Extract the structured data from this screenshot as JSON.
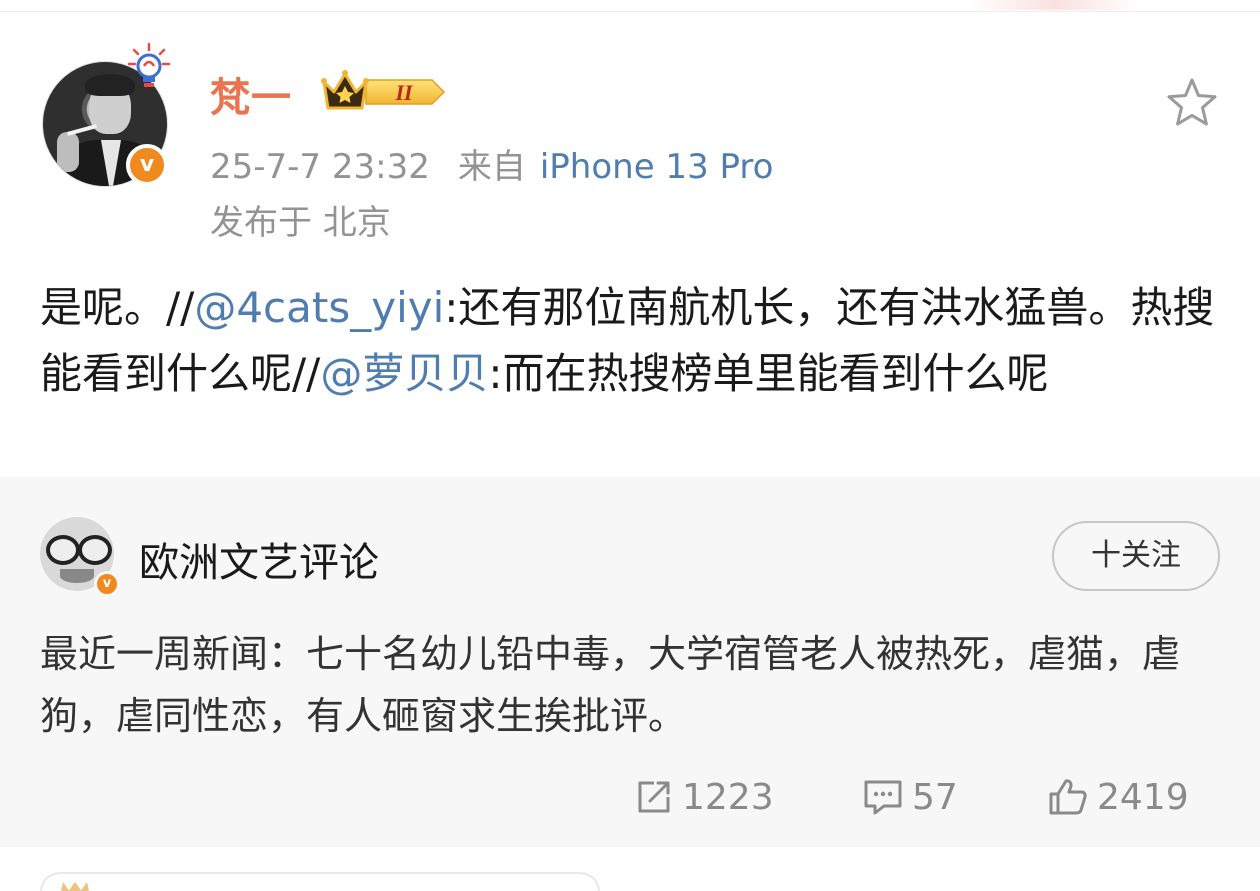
{
  "post": {
    "username": "梵一",
    "level_badge": "II",
    "verified_mark": "v",
    "date": "25-7-7 23:32",
    "source_prefix": "来自",
    "source_device": "iPhone 13 Pro",
    "location_label": "发布于 北京",
    "text": {
      "t1": "是呢。//",
      "m1": "@4cats_yiyi",
      "t2": ":还有那位南航机长，还有洪水猛兽。热搜能看到什么呢//",
      "m2": "@萝贝贝",
      "t3": ":而在热搜榜单里能看到什么呢"
    }
  },
  "repost": {
    "author": "欧洲文艺评论",
    "verified_mark": "v",
    "follow_label": "十关注",
    "text": "最近一周新闻：七十名幼儿铅中毒，大学宿管老人被热死，虐猫，虐狗，虐同性恋，有人砸窗求生挨批评。",
    "counts": {
      "reposts": "1223",
      "comments": "57",
      "likes": "2419"
    }
  },
  "icons": [
    "star-icon",
    "crown-icon",
    "lightbulb-icon",
    "repost-icon",
    "comment-icon",
    "like-icon"
  ],
  "colors": {
    "username": "#eb7350",
    "link": "#507daf",
    "meta": "#939393",
    "verify": "#f08a1e",
    "repost_bg": "#f7f7f7"
  }
}
